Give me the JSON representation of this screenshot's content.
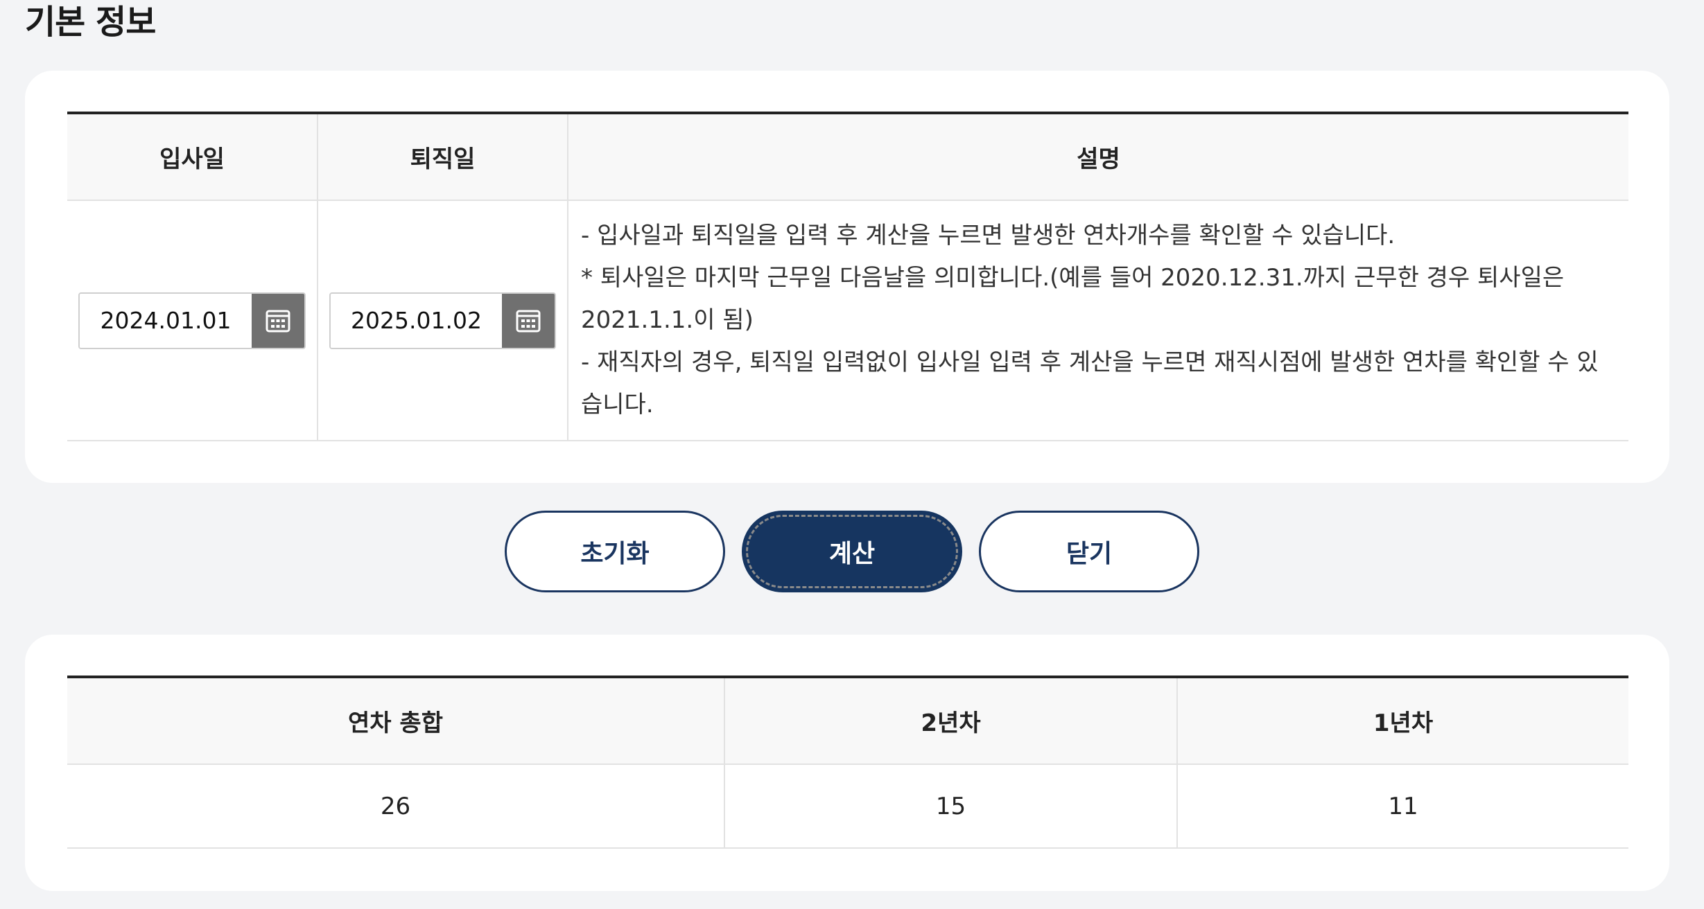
{
  "section_title": "기본 정보",
  "info_table": {
    "headers": [
      "입사일",
      "퇴직일",
      "설명"
    ],
    "hire_date": "2024.01.01",
    "retire_date": "2025.01.02",
    "description": [
      "- 입사일과 퇴직일을 입력 후 계산을 누르면 발생한 연차개수를 확인할 수 있습니다.",
      "* 퇴사일은 마지막 근무일 다음날을 의미합니다.(예를 들어 2020.12.31.까지 근무한 경우 퇴사일은 2021.1.1.이 됨)",
      "- 재직자의 경우, 퇴직일 입력없이 입사일 입력 후 계산을 누르면 재직시점에 발생한 연차를 확인할 수 있습니다."
    ],
    "calendar_icon": "calendar-icon"
  },
  "buttons": {
    "reset": "초기화",
    "calculate": "계산",
    "close": "닫기"
  },
  "result_table": {
    "headers": [
      "연차 총합",
      "2년차",
      "1년차"
    ],
    "values": [
      "26",
      "15",
      "11"
    ]
  },
  "colors": {
    "primary": "#163560",
    "background": "#f3f4f6",
    "card": "#ffffff",
    "calendar_button": "#707070"
  }
}
